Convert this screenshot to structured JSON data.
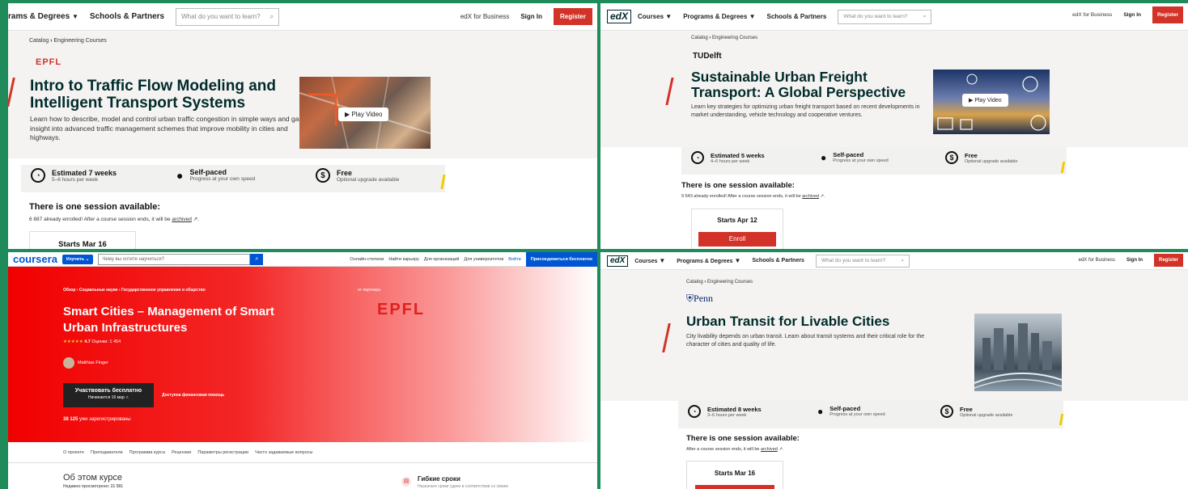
{
  "colors": {
    "edx_red": "#d23228",
    "edx_dark": "#002b2b",
    "coursera_blue": "#0056d2",
    "accent_yellow": "#f0cc00",
    "background_green": "#1f8a5a"
  },
  "p1": {
    "nav1": "rams & Degrees",
    "nav2": "Schools & Partners",
    "search_placeholder": "What do you want to learn?",
    "business": "edX for Business",
    "signin": "Sign In",
    "register": "Register",
    "crumb_root": "Catalog",
    "crumb_leaf": "Engineering Courses",
    "school": "EPFL",
    "title": "Intro to Traffic Flow Modeling and Intelligent Transport Systems",
    "desc": "Learn how to describe, model and control urban traffic congestion in simple ways and gain insight into advanced traffic management schemes that improve mobility in cities and highways.",
    "play": "Play Video",
    "s1_title": "Estimated 7 weeks",
    "s1_sub": "5–6 hours per week",
    "s2_title": "Self-paced",
    "s2_sub": "Progress at your own speed",
    "s3_title": "Free",
    "s3_sub": "Optional upgrade available",
    "session_title": "There is one session available:",
    "enrolled": "6 887 already enrolled! After a course session ends, it will be",
    "archived": "archived",
    "start": "Starts Mar 16"
  },
  "p2": {
    "logo": "edX",
    "nav0": "Courses",
    "nav1": "Programs & Degrees",
    "nav2": "Schools & Partners",
    "search_placeholder": "What do you want to learn?",
    "business": "edX for Business",
    "signin": "Sign In",
    "register": "Register",
    "crumb_root": "Catalog",
    "crumb_leaf": "Engineering Courses",
    "school": "TUDelft",
    "title": "Sustainable Urban Freight Transport: A Global Perspective",
    "desc": "Learn key strategies for optimizing urban freight transport based on recent developments in market understanding, vehicle technology and cooperative ventures.",
    "play": "Play Video",
    "s1_title": "Estimated 5 weeks",
    "s1_sub": "4–6 hours per week",
    "s2_title": "Self-paced",
    "s2_sub": "Progress at your own speed",
    "s3_title": "Free",
    "s3_sub": "Optional upgrade available",
    "session_title": "There is one session available:",
    "enrolled": "9 643 already enrolled! After a course session ends, it will be",
    "archived": "archived",
    "start": "Starts Apr 12",
    "enroll": "Enroll"
  },
  "p3": {
    "logo": "coursera",
    "learn": "Изучить",
    "search_placeholder": "Чему вы хотите научиться?",
    "h1": "Онлайн-степени",
    "h2": "Найти карьеру",
    "h3": "Для организаций",
    "h4": "Для университетов",
    "login": "Войти",
    "join": "Присоединиться бесплатно",
    "crumb1": "Обзор",
    "crumb2": "Социальные науки",
    "crumb3": "Государственное управление и общество",
    "partner_label": "от партнера",
    "partner": "EPFL",
    "title": "Smart Cities – Management of Smart Urban Infrastructures",
    "stars": "★★★★★",
    "rating": "4.7",
    "ratings_count": "Оценки: 1 454",
    "instructor": "Matthias Finger",
    "cta": "Участвовать бесплатно",
    "cta_sub": "Начинается 16 мар. г.",
    "aid": "Доступна финансовая помощь",
    "enrolled_num": "38 125",
    "enrolled_text": "уже зарегистрированы",
    "t1": "О проекте",
    "t2": "Преподаватели",
    "t3": "Программа курса",
    "t4": "Рецензии",
    "t5": "Параметры регистрации",
    "t6": "Часто задаваемые вопросы",
    "about": "Об этом курсе",
    "views": "Недавно просмотрено: 21 581",
    "flex": "Гибкие сроки",
    "flex_sub": "Назначьте сроки сдачи в соответствии со своим"
  },
  "p4": {
    "logo": "edX",
    "nav0": "Courses",
    "nav1": "Programs & Degrees",
    "nav2": "Schools & Partners",
    "search_placeholder": "What do you want to learn?",
    "business": "edX for Business",
    "signin": "Sign In",
    "register": "Register",
    "crumb_root": "Catalog",
    "crumb_leaf": "Engineering Courses",
    "school": "Penn",
    "title": "Urban Transit for Livable Cities",
    "desc": "City livability depends on urban transit. Learn about transit systems and their critical role for the character of cities and quality of life.",
    "s1_title": "Estimated 8 weeks",
    "s1_sub": "3–6 hours per week",
    "s2_title": "Self-paced",
    "s2_sub": "Progress at your own speed",
    "s3_title": "Free",
    "s3_sub": "Optional upgrade available",
    "session_title": "There is one session available:",
    "enrolled": "After a course session ends, it will be",
    "archived": "archived",
    "start": "Starts Mar 16"
  }
}
